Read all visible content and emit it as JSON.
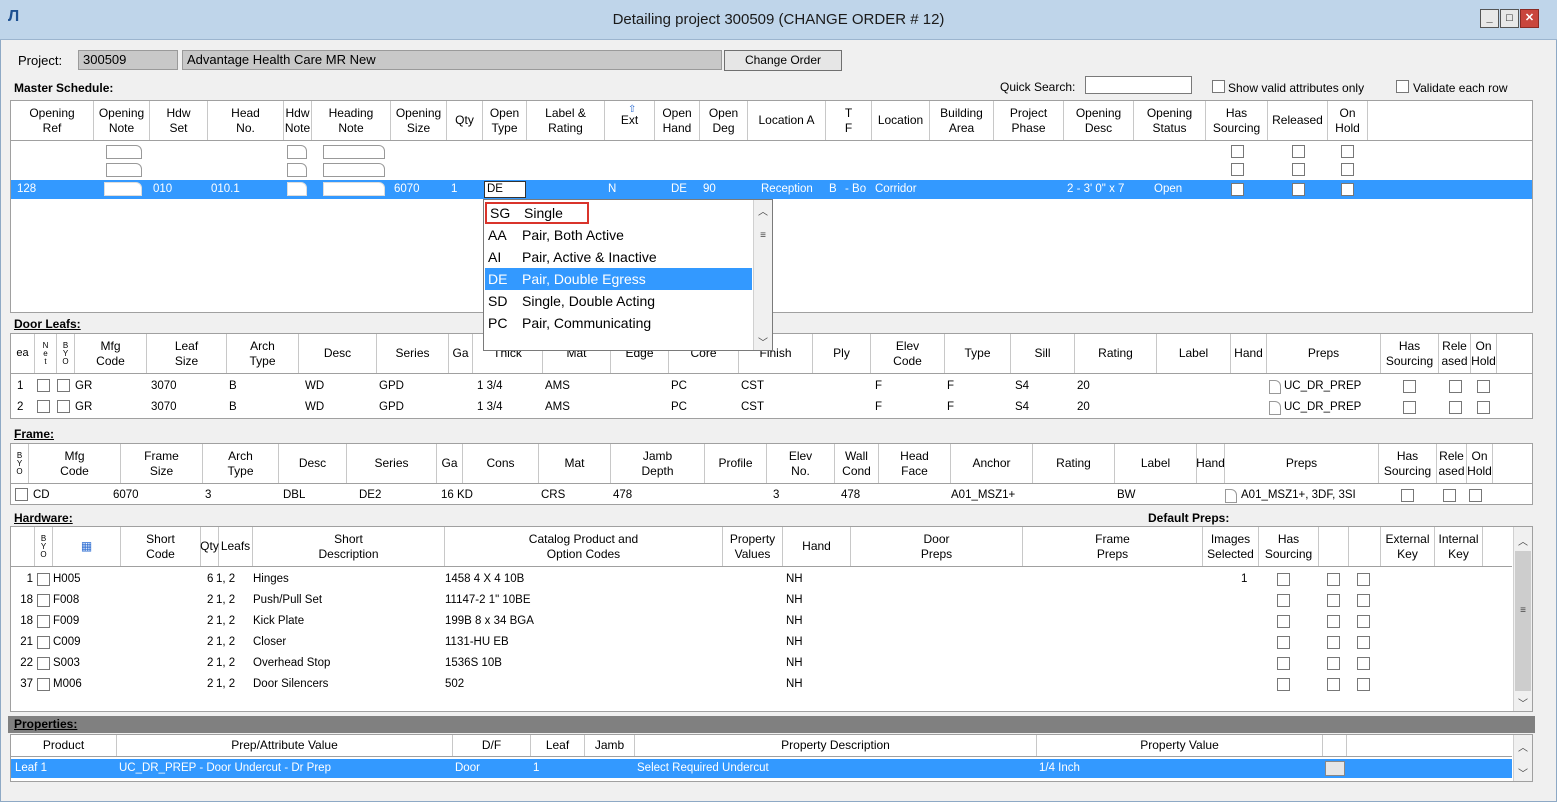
{
  "window": {
    "title": "Detailing project 300509   (CHANGE ORDER # 12)",
    "icon": "app-logo-icon"
  },
  "project": {
    "label": "Project:",
    "id": "300509",
    "name": "Advantage Health Care MR New",
    "change_order_button": "Change Order"
  },
  "master": {
    "title": "Master Schedule:",
    "quick_search_label": "Quick Search:",
    "quick_search_value": "",
    "show_valid_label": "Show valid attributes only",
    "validate_label": "Validate each row",
    "columns": [
      "Opening\nRef",
      "Opening\nNote",
      "Hdw\nSet",
      "Head\nNo.",
      "Hdw\nNote",
      "Heading\nNote",
      "Opening\nSize",
      "Qty",
      "Open\nType",
      "Label &\nRating",
      "Ext",
      "Open\nHand",
      "Open\nDeg",
      "Location A",
      "T\nF",
      "Location",
      "Building\nArea",
      "Project\nPhase",
      "Opening\nDesc",
      "Opening\nStatus",
      "Has\nSourcing",
      "Released",
      "On\nHold"
    ],
    "row": {
      "ref": "128",
      "hdw_set": "010",
      "head_no": "010.1",
      "size": "6070",
      "qty": "1",
      "open_type": "DE",
      "ext": "N",
      "hand": "DE",
      "deg": "90",
      "location_a": "Reception",
      "tf": "B",
      "tf2": "- Bo",
      "location": "Corridor",
      "desc": "2 - 3' 0\" x 7",
      "status": "Open"
    }
  },
  "dropdown": {
    "options": [
      {
        "code": "SG",
        "label": "Single",
        "highlighted_box": true
      },
      {
        "code": "AA",
        "label": "Pair, Both Active"
      },
      {
        "code": "AI",
        "label": "Pair, Active & Inactive"
      },
      {
        "code": "DE",
        "label": "Pair, Double Egress",
        "selected": true
      },
      {
        "code": "SD",
        "label": "Single, Double Acting"
      },
      {
        "code": "PC",
        "label": "Pair, Communicating"
      }
    ]
  },
  "door_leafs": {
    "title": "Door Leafs:",
    "columns": [
      "Mfg\nCode",
      "Leaf\nSize",
      "Arch\nType",
      "Desc",
      "Series",
      "Ga",
      "Thick",
      "Mat",
      "Edge",
      "Core",
      "Finish",
      "Ply",
      "Elev\nCode",
      "Type",
      "Sill",
      "Rating",
      "Label",
      "Hand",
      "Preps",
      "Has\nSourcing",
      "Rele\nased",
      "On\nHold"
    ],
    "rows": [
      {
        "n": "1",
        "mfg": "GR",
        "size": "3070",
        "arch": "B",
        "desc": "WD",
        "series": "GPD",
        "thick": "1 3/4",
        "mat": "AMS",
        "core": "PC",
        "finish": "CST",
        "elev": "F",
        "type": "F",
        "sill": "S4",
        "rating": "20",
        "preps": "UC_DR_PREP"
      },
      {
        "n": "2",
        "mfg": "GR",
        "size": "3070",
        "arch": "B",
        "desc": "WD",
        "series": "GPD",
        "thick": "1 3/4",
        "mat": "AMS",
        "core": "PC",
        "finish": "CST",
        "elev": "F",
        "type": "F",
        "sill": "S4",
        "rating": "20",
        "preps": "UC_DR_PREP"
      }
    ]
  },
  "frame": {
    "title": "Frame:",
    "columns": [
      "Mfg\nCode",
      "Frame\nSize",
      "Arch\nType",
      "Desc",
      "Series",
      "Ga",
      "Cons",
      "Mat",
      "Jamb\nDepth",
      "Profile",
      "Elev\nNo.",
      "Wall\nCond",
      "Head\nFace",
      "Anchor",
      "Rating",
      "Label",
      "Hand",
      "Preps",
      "Has\nSourcing",
      "Rele\nased",
      "On\nHold"
    ],
    "row": {
      "mfg": "CD",
      "size": "6070",
      "arch": "3",
      "desc": "DBL",
      "series": "DE2",
      "ga": "16",
      "cons": "KD",
      "mat": "CRS",
      "jamb": "478",
      "elev": "3",
      "wall": "478",
      "anchor": "A01_MSZ1+",
      "label": "BW",
      "preps": "A01_MSZ1+, 3DF, 3SI"
    }
  },
  "hardware": {
    "title": "Hardware:",
    "default_preps": "Default Preps:",
    "columns": [
      "Short\nCode",
      "Qty",
      "Leafs",
      "Short\nDescription",
      "Catalog Product and\nOption Codes",
      "Property\nValues",
      "Hand",
      "Door\nPreps",
      "Frame\nPreps",
      "Images\nSelected",
      "Has\nSourcing",
      "External\nKey",
      "Internal\nKey"
    ],
    "rows": [
      {
        "n": "1",
        "code": "H005",
        "qty": "6",
        "leafs": "1, 2",
        "desc": "Hinges",
        "catalog": "1458 4 X 4 10B",
        "hand": "NH",
        "images": "1"
      },
      {
        "n": "18",
        "code": "F008",
        "qty": "2",
        "leafs": "1, 2",
        "desc": "Push/Pull Set",
        "catalog": "11147-2 1\" 10BE",
        "hand": "NH",
        "images": ""
      },
      {
        "n": "18",
        "code": "F009",
        "qty": "2",
        "leafs": "1, 2",
        "desc": "Kick Plate",
        "catalog": "199B 8 x 34 BGA",
        "hand": "NH",
        "images": ""
      },
      {
        "n": "21",
        "code": "C009",
        "qty": "2",
        "leafs": "1, 2",
        "desc": "Closer",
        "catalog": "1131-HU EB",
        "hand": "NH",
        "images": ""
      },
      {
        "n": "22",
        "code": "S003",
        "qty": "2",
        "leafs": "1, 2",
        "desc": "Overhead Stop",
        "catalog": "1536S 10B",
        "hand": "NH",
        "images": ""
      },
      {
        "n": "37",
        "code": "M006",
        "qty": "2",
        "leafs": "1, 2",
        "desc": "Door Silencers",
        "catalog": "502",
        "hand": "NH",
        "images": ""
      }
    ]
  },
  "properties": {
    "title": "Properties:",
    "columns": [
      "Product",
      "Prep/Attribute Value",
      "D/F",
      "Leaf",
      "Jamb",
      "Property Description",
      "Property Value"
    ],
    "row": {
      "product": "Leaf 1",
      "value": "UC_DR_PREP - Door Undercut - Dr Prep",
      "df": "Door",
      "leaf": "1",
      "jamb": "",
      "desc": "Select Required Undercut",
      "pval": "1/4 Inch"
    }
  },
  "colors": {
    "title_bar": "#bfd5ea",
    "selection": "#3399ff",
    "highlight_box": "#d9342b"
  }
}
